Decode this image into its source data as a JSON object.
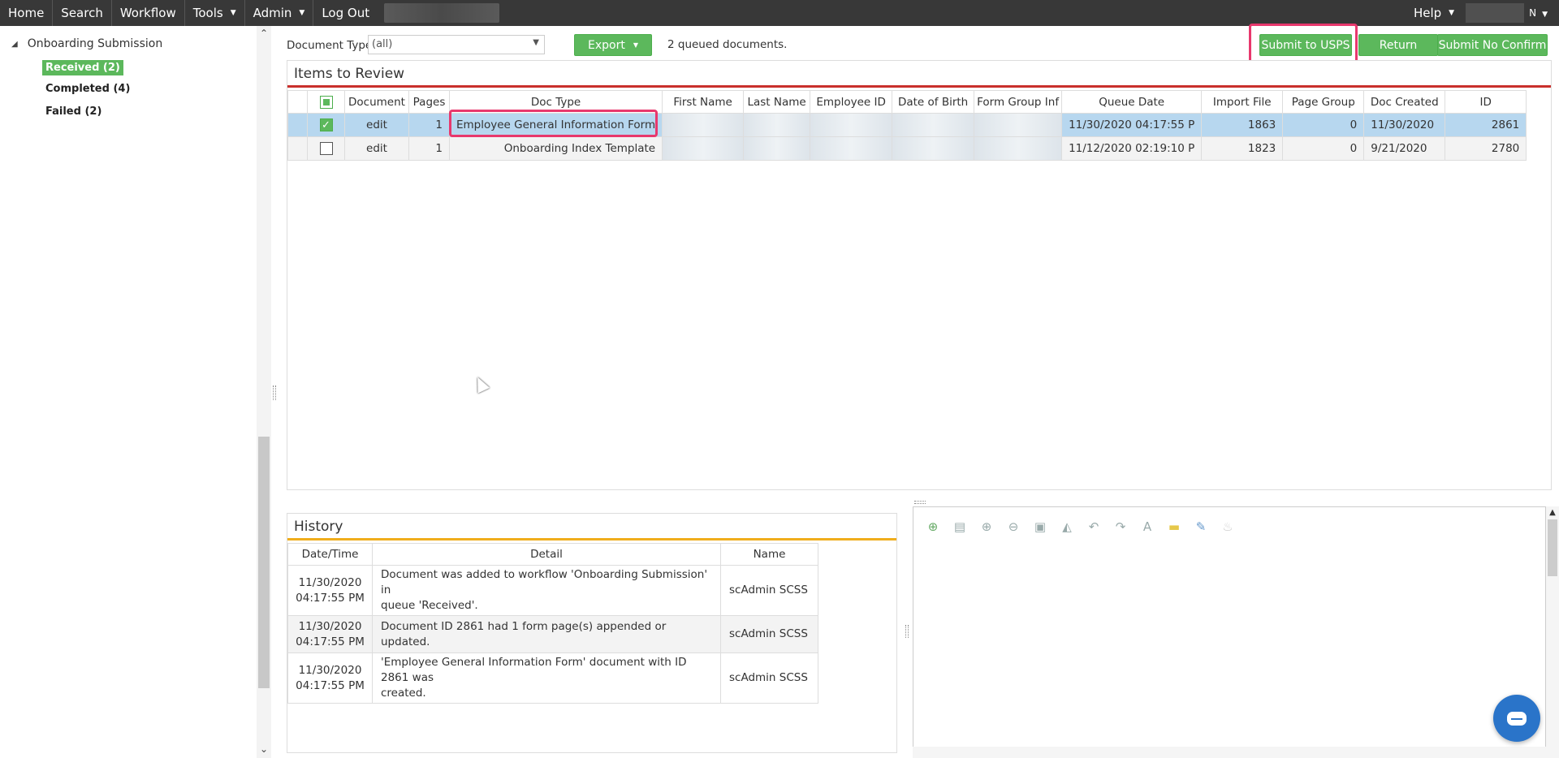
{
  "topnav": {
    "items": [
      {
        "label": "Home",
        "has_menu": false
      },
      {
        "label": "Search",
        "has_menu": false
      },
      {
        "label": "Workflow",
        "has_menu": false
      },
      {
        "label": "Tools",
        "has_menu": true
      },
      {
        "label": "Admin",
        "has_menu": true
      },
      {
        "label": "Log Out",
        "has_menu": false
      }
    ],
    "help_label": "Help",
    "user_suffix": "N"
  },
  "sidebar": {
    "workflow_label": "Onboarding Submission",
    "queues": [
      {
        "label": "Received (2)",
        "active": true
      },
      {
        "label": "Completed (4)",
        "active": false
      },
      {
        "label": "Failed (2)",
        "active": false
      }
    ]
  },
  "toolbar": {
    "doc_type_label": "Document Type",
    "doc_type_value": "(all)",
    "export_label": "Export",
    "queued_text": "2 queued documents.",
    "submit_usps_label": "Submit to USPS",
    "return_label": "Return",
    "submit_no_confirm_label": "Submit No Confirm"
  },
  "items": {
    "title": "Items to Review",
    "columns": [
      "Document",
      "Pages",
      "Doc Type",
      "First Name",
      "Last Name",
      "Employee ID",
      "Date of Birth",
      "Form Group Inf",
      "Queue Date",
      "Import File",
      "Page Group",
      "Doc Created",
      "ID"
    ],
    "rows": [
      {
        "selected": true,
        "document": "edit",
        "pages": "1",
        "doc_type": "Employee General Information Form",
        "queue_date": "11/30/2020 04:17:55 P",
        "import_file": "1863",
        "page_group": "0",
        "doc_created": "11/30/2020",
        "id": "2861"
      },
      {
        "selected": false,
        "document": "edit",
        "pages": "1",
        "doc_type": "Onboarding Index Template",
        "queue_date": "11/12/2020 02:19:10 P",
        "import_file": "1823",
        "page_group": "0",
        "doc_created": "9/21/2020",
        "id": "2780"
      }
    ]
  },
  "history": {
    "title": "History",
    "columns": [
      "Date/Time",
      "Detail",
      "Name"
    ],
    "rows": [
      {
        "date": "11/30/2020",
        "time": "04:17:55 PM",
        "detail_1": "Document was added to workflow 'Onboarding Submission' in",
        "detail_2": "queue 'Received'.",
        "name": "scAdmin SCSS"
      },
      {
        "date": "11/30/2020",
        "time": "04:17:55 PM",
        "detail_1": "Document ID 2861 had 1 form page(s) appended or updated.",
        "detail_2": "",
        "name": "scAdmin SCSS"
      },
      {
        "date": "11/30/2020",
        "time": "04:17:55 PM",
        "detail_1": "'Employee General Information Form' document with ID 2861 was",
        "detail_2": "created.",
        "name": "scAdmin SCSS"
      }
    ]
  },
  "viewer": {
    "tools": [
      "add-page-icon",
      "print-icon",
      "zoom-in-icon",
      "zoom-out-icon",
      "fit-icon",
      "flip-horizontal-icon",
      "rotate-left-icon",
      "rotate-right-icon",
      "text-annotation-icon",
      "sticky-note-icon",
      "redact-icon",
      "burn-icon"
    ]
  },
  "colors": {
    "accent_green": "#5cb85c",
    "highlight": "#e8386d",
    "items_rule": "#c9302c",
    "history_rule": "#f0ad1c",
    "selected_row": "#b7d7ef"
  }
}
